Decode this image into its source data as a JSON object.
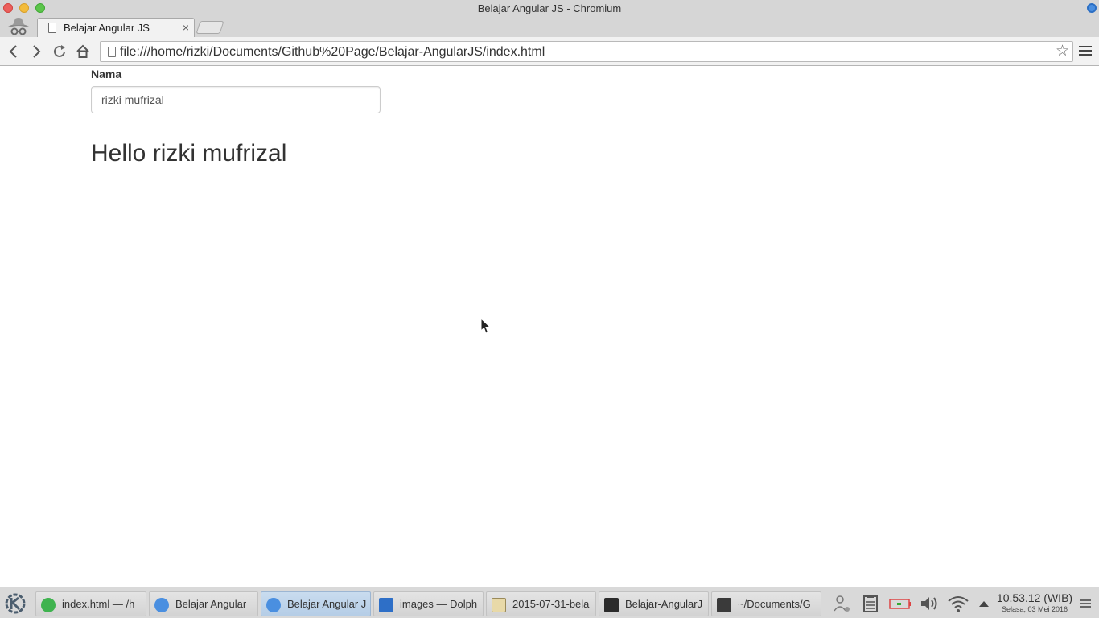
{
  "window": {
    "title": "Belajar Angular JS - Chromium"
  },
  "tab": {
    "title": "Belajar Angular JS",
    "close_glyph": "×"
  },
  "toolbar": {
    "back_glyph": "‹",
    "forward_glyph": "›",
    "reload_glyph": "↻",
    "url": "file:///home/rizki/Documents/Github%20Page/Belajar-AngularJS/index.html",
    "star_glyph": "☆"
  },
  "page": {
    "field_label": "Nama",
    "field_value": "rizki mufrizal",
    "greeting": "Hello rizki mufrizal"
  },
  "taskbar": {
    "tasks": [
      {
        "label": "index.html — /h",
        "icon": "web-icon",
        "color": "#3fb34f"
      },
      {
        "label": "Belajar Angular",
        "icon": "chromium-icon",
        "color": "#4a8fe0"
      },
      {
        "label": "Belajar Angular J",
        "icon": "chromium-icon",
        "color": "#4a8fe0",
        "active": true
      },
      {
        "label": "images — Dolph",
        "icon": "dolphin-icon",
        "color": "#2e6fc7"
      },
      {
        "label": "2015-07-31-bela",
        "icon": "text-editor-icon",
        "color": "#e8d9a8"
      },
      {
        "label": "Belajar-AngularJ",
        "icon": "terminal-icon",
        "color": "#2b2b2b"
      },
      {
        "label": "~/Documents/G",
        "icon": "sublime-text-icon",
        "color": "#3a3a3a"
      }
    ],
    "clock_time": "10.53.12 (WIB)",
    "clock_date": "Selasa, 03 Mei 2016"
  }
}
